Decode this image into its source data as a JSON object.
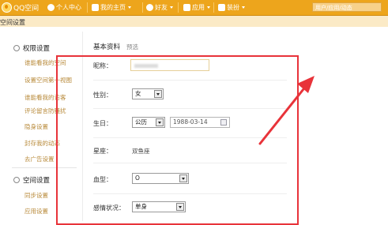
{
  "topbar": {
    "logo": "QQ空间",
    "nav": [
      {
        "label": "个人中心",
        "icon": "person-icon"
      },
      {
        "label": "我的主页",
        "icon": "home-icon"
      },
      {
        "label": "好友",
        "icon": "friends-icon"
      },
      {
        "label": "应用",
        "icon": "apps-icon"
      },
      {
        "label": "装扮",
        "icon": "shirt-icon"
      }
    ],
    "search_placeholder": "用户/应用/动态"
  },
  "subheader": {
    "title": "空间设置"
  },
  "sidebar": {
    "permission_title": "权限设置",
    "permission_items": [
      "谁能看我的空间",
      "设置空间第一视图",
      "谁能看我的访客",
      "评论留言防骚扰",
      "隐身设置",
      "封存我的动态",
      "去广告设置"
    ],
    "space_title": "空间设置",
    "space_items": [
      "同步设置",
      "应用设置"
    ]
  },
  "tabs": {
    "main": "基本资料",
    "preview": "预选"
  },
  "form": {
    "nickname_label": "昵称：",
    "gender_label": "性别：",
    "gender_value": "女",
    "birthday_label": "生日：",
    "calendar_value": "公历",
    "date_value": "1988-03-14",
    "zodiac_label": "星座：",
    "zodiac_value": "双鱼座",
    "blood_label": "血型：",
    "blood_value": "O",
    "relationship_label": "感情状况：",
    "relationship_value": "单身"
  },
  "colors": {
    "topbar": "#eda51c",
    "subheader": "#fbeac6",
    "annotation": "#e8333a",
    "sidebar_link": "#b88a3a"
  }
}
